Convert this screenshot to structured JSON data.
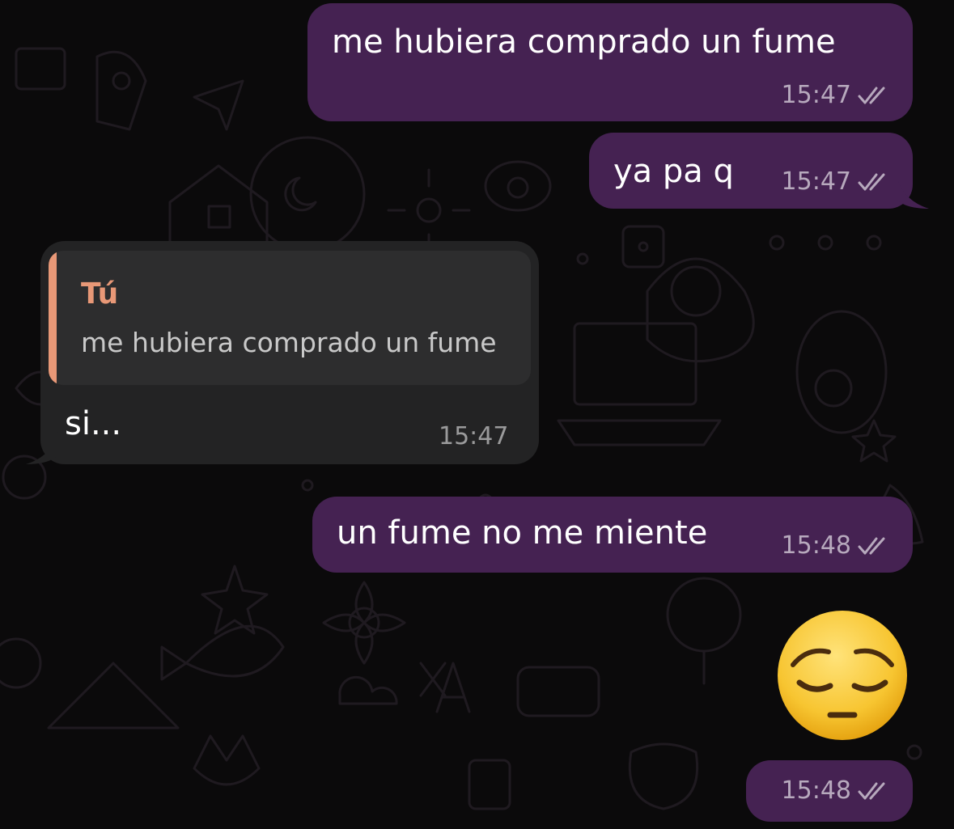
{
  "messages": [
    {
      "id": "m1",
      "direction": "outgoing",
      "text": "me hubiera comprado un fume",
      "time": "15:47",
      "status": "read"
    },
    {
      "id": "m2",
      "direction": "outgoing",
      "text": "ya pa q",
      "time": "15:47",
      "status": "read"
    },
    {
      "id": "m3",
      "direction": "incoming",
      "text": "si...",
      "time": "15:47",
      "reply": {
        "author": "Tú",
        "text": "me hubiera comprado un fume"
      }
    },
    {
      "id": "m4",
      "direction": "outgoing",
      "text": "un fume no me miente",
      "time": "15:48",
      "status": "read"
    },
    {
      "id": "m5",
      "direction": "outgoing",
      "emoji": "pensive-face-emoji",
      "time": "15:48",
      "status": "read"
    }
  ],
  "icons": {
    "read_receipt": "double-check-icon",
    "wallpaper": "doodle-wallpaper-pattern"
  },
  "colors": {
    "background": "#0b0a0b",
    "outgoing_bubble": "#452252",
    "incoming_bubble": "#232324",
    "quote_accent": "#e89877",
    "outgoing_meta": "#b7a9bd",
    "incoming_meta": "#9a9a9b"
  }
}
